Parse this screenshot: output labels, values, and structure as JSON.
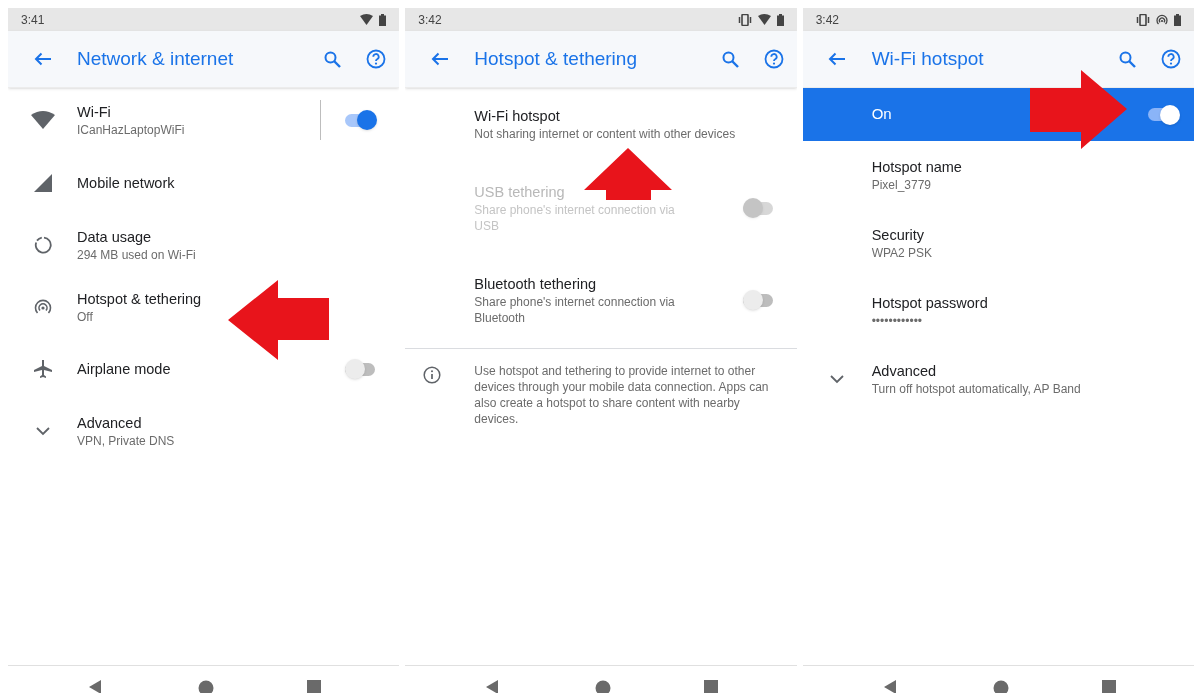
{
  "screens": [
    {
      "status_time": "3:41",
      "status_icons": [
        {
          "kind": "wifi"
        },
        {
          "kind": "battery"
        }
      ],
      "title": "Network & internet",
      "annotation": {
        "kind": "arrow-left"
      },
      "items": [
        {
          "kind": "wifi",
          "title": "Wi-Fi",
          "subtitle": "ICanHazLaptopWiFi",
          "on": true,
          "disabled": false
        },
        {
          "kind": "signal",
          "title": "Mobile network",
          "disabled": false
        },
        {
          "kind": "data",
          "title": "Data usage",
          "subtitle": "294 MB used on Wi-Fi",
          "disabled": false
        },
        {
          "kind": "hotspot",
          "title": "Hotspot & tethering",
          "subtitle": "Off",
          "disabled": false
        },
        {
          "kind": "airplane",
          "title": "Airplane mode",
          "on": false,
          "disabled": false
        },
        {
          "kind": "expand",
          "title": "Advanced",
          "subtitle": "VPN, Private DNS",
          "disabled": false
        }
      ]
    },
    {
      "status_time": "3:42",
      "status_icons": [
        {
          "kind": "vibrate"
        },
        {
          "kind": "wifi"
        },
        {
          "kind": "battery"
        }
      ],
      "title": "Hotspot & tethering",
      "annotation": {
        "kind": "arrow-up"
      },
      "items": [
        {
          "kind": "plain",
          "title": "Wi-Fi hotspot",
          "subtitle": "Not sharing internet or content with other devices",
          "disabled": false
        },
        {
          "kind": "plain",
          "title": "USB tethering",
          "subtitle": "Share phone's internet connection via USB",
          "on": false,
          "disabled": true
        },
        {
          "kind": "plain",
          "title": "Bluetooth tethering",
          "subtitle": "Share phone's internet connection via Bluetooth",
          "on": false,
          "disabled": false
        }
      ],
      "footer": "Use hotspot and tethering to provide internet to other devices through your mobile data connection. Apps can also create a hotspot to share content with nearby devices."
    },
    {
      "status_time": "3:42",
      "status_icons": [
        {
          "kind": "vibrate"
        },
        {
          "kind": "hotspot"
        },
        {
          "kind": "battery"
        }
      ],
      "title": "Wi-Fi hotspot",
      "annotation": {
        "kind": "arrow-right"
      },
      "master": {
        "label": "On",
        "on": true
      },
      "items": [
        {
          "kind": "plain",
          "title": "Hotspot name",
          "subtitle": "Pixel_3779",
          "disabled": false
        },
        {
          "kind": "plain",
          "title": "Security",
          "subtitle": "WPA2 PSK",
          "disabled": false
        },
        {
          "kind": "plain",
          "title": "Hotspot password",
          "subtitle": "••••••••••••",
          "disabled": false
        },
        {
          "kind": "expand",
          "title": "Advanced",
          "subtitle": "Turn off hotspot automatically, AP Band",
          "disabled": false
        }
      ]
    }
  ]
}
